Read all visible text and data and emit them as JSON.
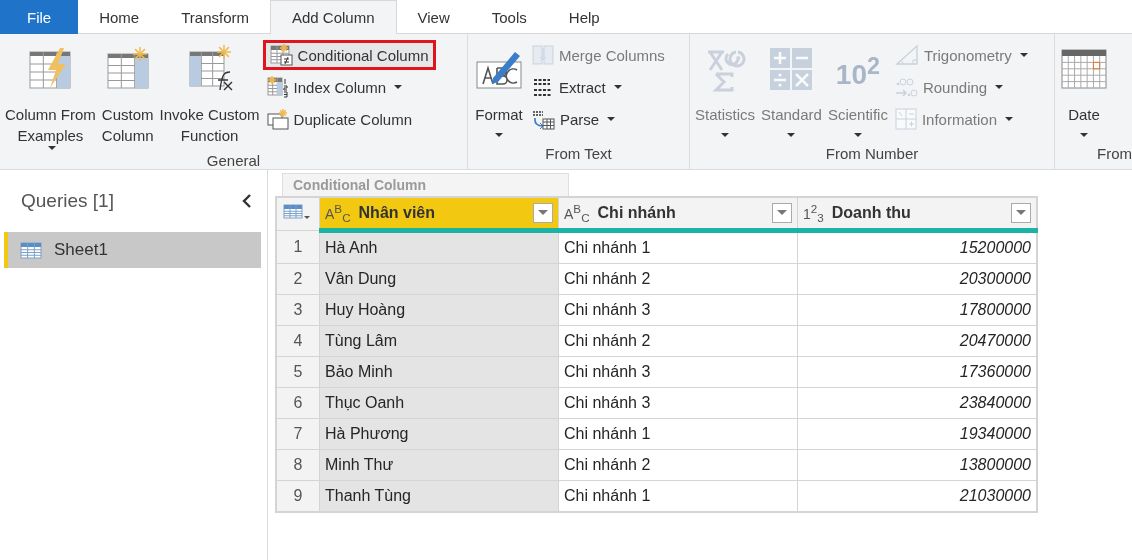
{
  "tabs": [
    {
      "label": "File",
      "kind": "file",
      "selected": false
    },
    {
      "label": "Home",
      "kind": "tab",
      "selected": false
    },
    {
      "label": "Transform",
      "kind": "tab",
      "selected": false
    },
    {
      "label": "Add Column",
      "kind": "tab",
      "selected": true
    },
    {
      "label": "View",
      "kind": "tab",
      "selected": false
    },
    {
      "label": "Tools",
      "kind": "tab",
      "selected": false
    },
    {
      "label": "Help",
      "kind": "tab",
      "selected": false
    }
  ],
  "ribbon": {
    "groups": [
      {
        "label": "General",
        "items": [
          {
            "kind": "large",
            "label": "Column From\nExamples",
            "dropdown": true,
            "disabled": false,
            "highlighted": false
          },
          {
            "kind": "large",
            "label": "Custom\nColumn",
            "dropdown": false,
            "disabled": false,
            "highlighted": false
          },
          {
            "kind": "large",
            "label": "Invoke Custom\nFunction",
            "dropdown": false,
            "disabled": false,
            "highlighted": false
          },
          {
            "kind": "small",
            "label": "Conditional Column",
            "dropdown": false,
            "disabled": false,
            "highlighted": true
          },
          {
            "kind": "small",
            "label": "Index Column",
            "dropdown": true,
            "disabled": false,
            "highlighted": false
          },
          {
            "kind": "small",
            "label": "Duplicate Column",
            "dropdown": false,
            "disabled": false,
            "highlighted": false
          }
        ]
      },
      {
        "label": "From Text",
        "items": [
          {
            "kind": "large",
            "label": "Format",
            "dropdown": true,
            "disabled": false,
            "highlighted": false
          },
          {
            "kind": "small",
            "label": "Merge Columns",
            "dropdown": false,
            "disabled": true,
            "highlighted": false
          },
          {
            "kind": "small",
            "label": "Extract",
            "dropdown": true,
            "disabled": false,
            "highlighted": false
          },
          {
            "kind": "small",
            "label": "Parse",
            "dropdown": true,
            "disabled": false,
            "highlighted": false
          }
        ]
      },
      {
        "label": "From Number",
        "items": [
          {
            "kind": "large",
            "label": "Statistics",
            "dropdown": true,
            "disabled": true,
            "highlighted": false
          },
          {
            "kind": "large",
            "label": "Standard",
            "dropdown": true,
            "disabled": true,
            "highlighted": false
          },
          {
            "kind": "large",
            "glyph": "10$^{2}$",
            "label": "Scientific",
            "dropdown": true,
            "disabled": true,
            "highlighted": false
          },
          {
            "kind": "small",
            "label": "Trigonometry",
            "dropdown": true,
            "disabled": true,
            "highlighted": false
          },
          {
            "kind": "small",
            "label": "Rounding",
            "dropdown": true,
            "disabled": true,
            "highlighted": false
          },
          {
            "kind": "small",
            "label": "Information",
            "dropdown": true,
            "disabled": true,
            "highlighted": false
          }
        ]
      },
      {
        "label": "From",
        "items": [
          {
            "kind": "large",
            "label": "Date",
            "dropdown": true,
            "disabled": false,
            "highlighted": false
          }
        ]
      }
    ]
  },
  "sidebar": {
    "title": "Queries [1]",
    "items": [
      {
        "label": "Sheet1",
        "selected": true
      }
    ]
  },
  "tooltip": {
    "title": "Conditional Column"
  },
  "table": {
    "columns": [
      {
        "type": "A$^{B}$$_{C}$",
        "kind": "text",
        "name": "Nhân viên",
        "selected": true
      },
      {
        "type": "A$^{B}$$_{C}$",
        "kind": "text",
        "name": "Chi nhánh",
        "selected": false
      },
      {
        "type": "1$^{2}$$_{3}$",
        "kind": "number",
        "name": "Doanh thu",
        "selected": false
      }
    ],
    "rows": [
      {
        "index": "1",
        "cells": [
          "Hà Anh",
          "Chi nhánh 1",
          "15200000"
        ]
      },
      {
        "index": "2",
        "cells": [
          "Vân Dung",
          "Chi nhánh 2",
          "20300000"
        ]
      },
      {
        "index": "3",
        "cells": [
          "Huy Hoàng",
          "Chi nhánh 3",
          "17800000"
        ]
      },
      {
        "index": "4",
        "cells": [
          "Tùng Lâm",
          "Chi nhánh 2",
          "20470000"
        ]
      },
      {
        "index": "5",
        "cells": [
          "Bảo Minh",
          "Chi nhánh 3",
          "17360000"
        ]
      },
      {
        "index": "6",
        "cells": [
          "Thục Oanh",
          "Chi nhánh 3",
          "23840000"
        ]
      },
      {
        "index": "7",
        "cells": [
          "Hà Phương",
          "Chi nhánh 1",
          "19340000"
        ]
      },
      {
        "index": "8",
        "cells": [
          "Minh Thư",
          "Chi nhánh 2",
          "13800000"
        ]
      },
      {
        "index": "9",
        "cells": [
          "Thanh Tùng",
          "Chi nhánh 1",
          "21030000"
        ]
      }
    ]
  }
}
